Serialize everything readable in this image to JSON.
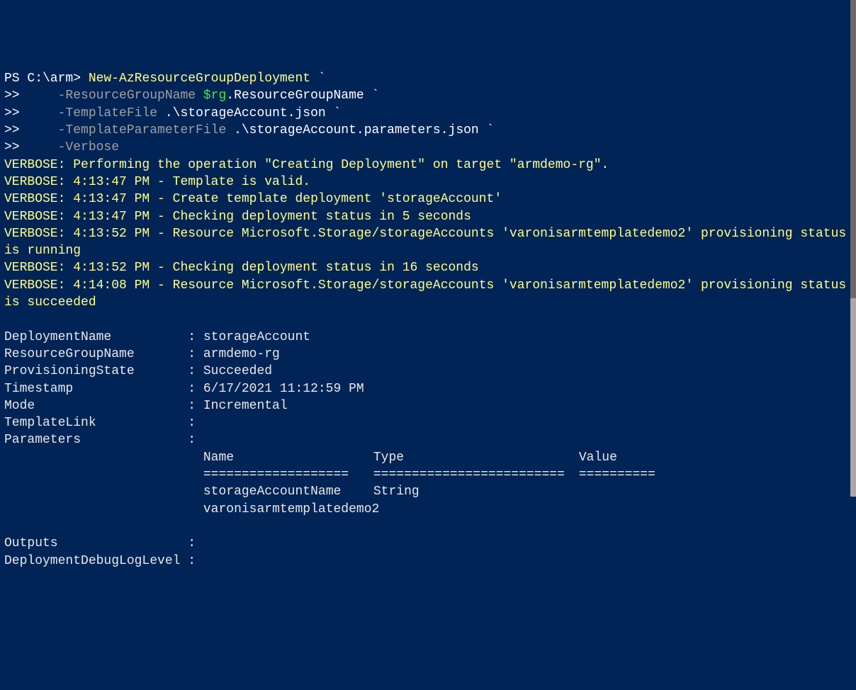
{
  "prompt": {
    "ps": "PS ",
    "path": "C:\\arm",
    "sep": "> ",
    "cont": ">>     "
  },
  "command": {
    "cmdlet": "New-AzResourceGroupDeployment",
    "backtick": " `",
    "params": {
      "rgName": "-ResourceGroupName ",
      "rgVar": "$rg",
      "rgMember": ".ResourceGroupName",
      "tmplFile": "-TemplateFile ",
      "tmplFilePath": ".\\storageAccount.json",
      "tmplParamFile": "-TemplateParameterFile ",
      "tmplParamFilePath": ".\\storageAccount.parameters.json",
      "verbose": "-Verbose"
    }
  },
  "verbose": {
    "line1": "VERBOSE: Performing the operation \"Creating Deployment\" on target \"armdemo-rg\".",
    "line2": "VERBOSE: 4:13:47 PM - Template is valid.",
    "line3": "VERBOSE: 4:13:47 PM - Create template deployment 'storageAccount'",
    "line4": "VERBOSE: 4:13:47 PM - Checking deployment status in 5 seconds",
    "line5": "VERBOSE: 4:13:52 PM - Resource Microsoft.Storage/storageAccounts 'varonisarmtemplatedemo2' provisioning status is running",
    "line6": "VERBOSE: 4:13:52 PM - Checking deployment status in 16 seconds",
    "line7": "VERBOSE: 4:14:08 PM - Resource Microsoft.Storage/storageAccounts 'varonisarmtemplatedemo2' provisioning status is succeeded"
  },
  "result": {
    "deploymentName": "DeploymentName          : storageAccount",
    "resourceGroupName": "ResourceGroupName       : armdemo-rg",
    "provisioningState": "ProvisioningState       : Succeeded",
    "timestamp": "Timestamp               : 6/17/2021 11:12:59 PM",
    "mode": "Mode                    : Incremental",
    "templateLink": "TemplateLink            :",
    "parametersLabel": "Parameters              :",
    "paramTable": {
      "indent": "                          ",
      "hName": "Name",
      "hType": "Type",
      "hValue": "Value",
      "row1_name": "storageAccountName",
      "row1_type": "String",
      "row2_value": "varonisarmtemplatedemo2"
    },
    "outputs": "Outputs                 :",
    "debugLog": "DeploymentDebugLogLevel :"
  }
}
